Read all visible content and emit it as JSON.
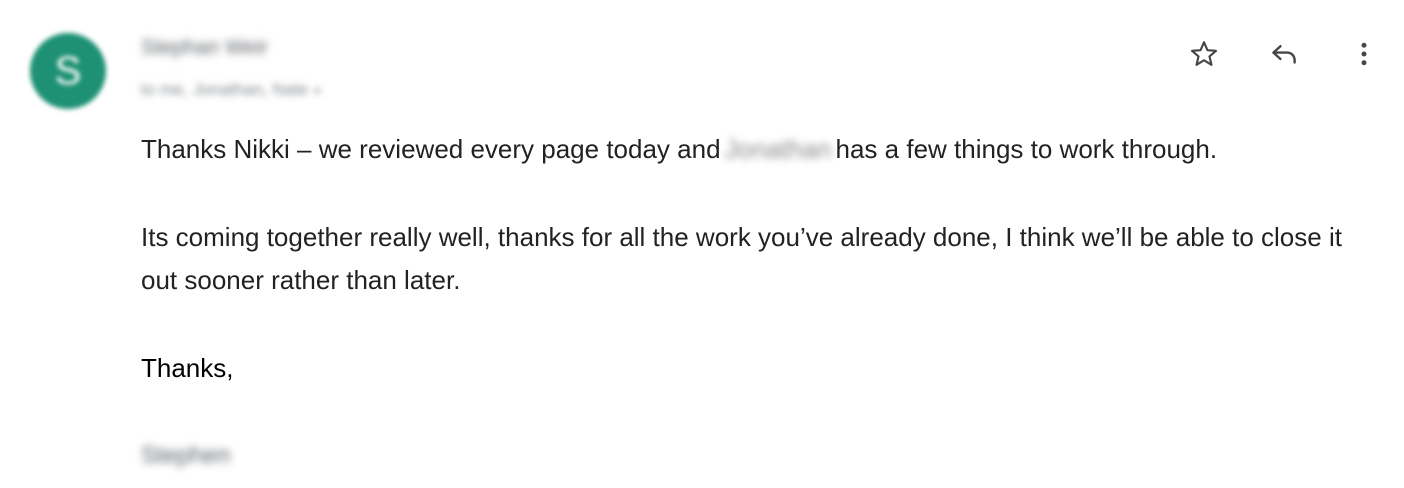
{
  "sender": {
    "avatar_initial": "S",
    "avatar_color": "#1e9174",
    "name": "Stephan Weir",
    "recipients": "to me, Jonathan, Nate",
    "recipients_caret": "▾"
  },
  "actions": {
    "star_icon": "star-outline",
    "reply_icon": "reply-arrow",
    "more_icon": "vertical-dots"
  },
  "message": {
    "p1_before": "Thanks Nikki – we reviewed every page today and",
    "p1_redacted": "Jonathan",
    "p1_after": "has a few things to work through.",
    "p2": "Its coming together really well, thanks for all the work you’ve already done, I think we’ll be able to close it out sooner rather than later.",
    "closing": "Thanks,",
    "signature": "Stephen"
  }
}
